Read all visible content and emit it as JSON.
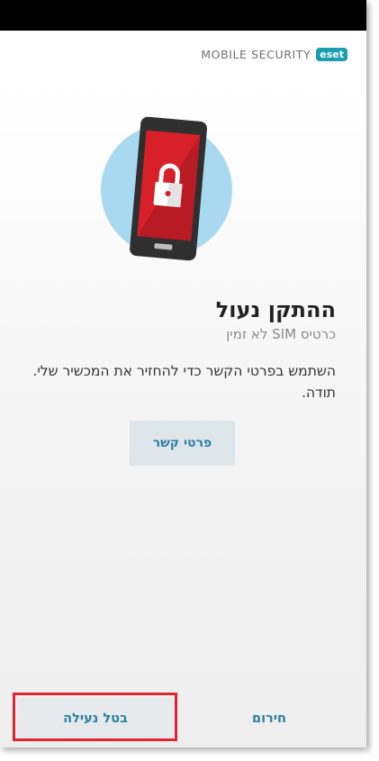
{
  "header": {
    "product_name": "MOBILE SECURITY",
    "logo_text": "eset"
  },
  "illustration": {
    "icon": "locked-phone-icon",
    "colors": {
      "circle": "#a9d8f1",
      "phone_body": "#2f2f2f",
      "screen": "#d8202a",
      "padlock": "#ffffff"
    }
  },
  "main": {
    "title": "ההתקן נעול",
    "subtitle": "כרטיס SIM לא זמין",
    "message": "השתמש בפרטי הקשר כדי להחזיר את המכשיר שלי. תודה.",
    "contact_button": "פרטי קשר"
  },
  "footer": {
    "cancel_lock_button": "בטל נעילה",
    "emergency_button": "חירום"
  },
  "colors": {
    "accent": "#2b7fa6",
    "highlight_border": "#e0232e"
  }
}
